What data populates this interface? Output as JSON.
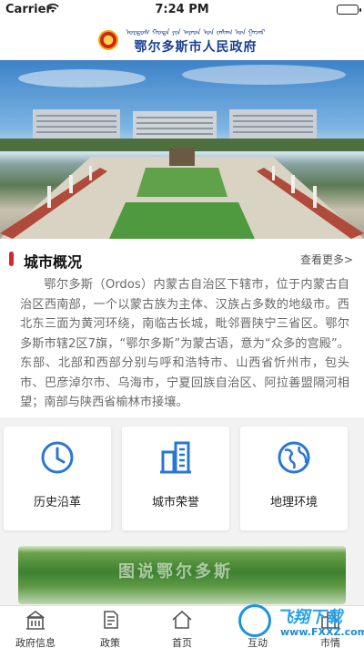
{
  "status": {
    "carrier": "Carrier",
    "time": "7:24 PM"
  },
  "header": {
    "title_mn": "ᠣᠷᠳᠣᠰ ᠬᠣᠲᠠ ᠶᠢᠨ ᠠᠷᠠᠳ ᠤᠨ ᠵᠠᠰᠠᠭ ᠤᠨ ᠭᠠᠵᠠᠷ",
    "title": "鄂尔多斯市人民政府"
  },
  "overview": {
    "title": "城市概况",
    "more": "查看更多>",
    "text": "鄂尔多斯（Ordos）内蒙古自治区下辖市，位于内蒙古自治区西南部，一个以蒙古族为主体、汉族占多数的地级市。西北东三面为黄河环绕，南临古长城，毗邻晋陕宁三省区。鄂尔多斯市辖2区7旗，“鄂尔多斯”为蒙古语，意为“众多的宫殿”。东部、北部和西部分别与呼和浩特市、山西省忻州市，包头市、巴彦淖尔市、乌海市，宁夏回族自治区、阿拉善盟隔河相望；南部与陕西省榆林市接壤。"
  },
  "cards": [
    {
      "label": "历史沿革",
      "icon": "clock-icon"
    },
    {
      "label": "城市荣誉",
      "icon": "building-icon"
    },
    {
      "label": "地理环境",
      "icon": "globe-icon"
    }
  ],
  "promo": {
    "text": "图说鄂尔多斯"
  },
  "tabs": [
    {
      "label": "政府信息",
      "icon": "government-building-icon"
    },
    {
      "label": "政策",
      "icon": "document-icon"
    },
    {
      "label": "首页",
      "icon": "home-icon"
    },
    {
      "label": "互动",
      "icon": "chat-icon"
    },
    {
      "label": "市情",
      "icon": "city-icon"
    }
  ],
  "watermark": {
    "title": "飞翔下载",
    "url": "www.FXXZ.com"
  },
  "colors": {
    "brand_blue": "#1c3f93",
    "accent_red": "#d8262e",
    "icon_blue": "#2b77d0"
  }
}
